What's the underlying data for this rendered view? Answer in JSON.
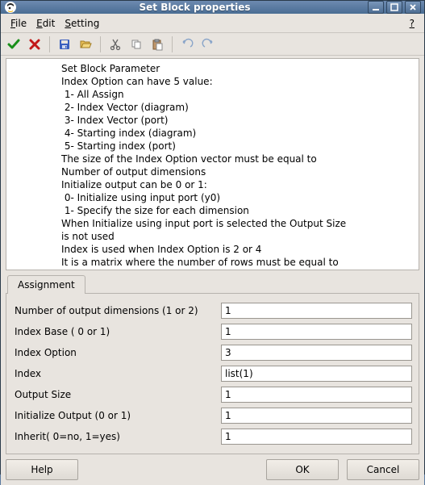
{
  "window": {
    "title": "Set Block properties"
  },
  "menu": {
    "file": "File",
    "edit": "Edit",
    "setting": "Setting",
    "help_q": "?"
  },
  "toolbar": {
    "ok_name": "apply-ok-icon",
    "cancel_name": "cancel-icon",
    "save_name": "save-icon",
    "open_name": "open-icon",
    "cut_name": "cut-icon",
    "copy_name": "copy-icon",
    "paste_name": "paste-icon",
    "undo_name": "undo-icon",
    "redo_name": "redo-icon"
  },
  "description": "Set Block Parameter\nIndex Option can have 5 value:\n 1- All Assign\n 2- Index Vector (diagram)\n 3- Index Vector (port)\n 4- Starting index (diagram)\n 5- Starting index (port)\nThe size of the Index Option vector must be equal to\nNumber of output dimensions\nInitialize output can be 0 or 1:\n 0- Initialize using input port (y0)\n 1- Specify the size for each dimension\nWhen Initialize using input port is selected the Output Size\nis not used\nIndex is used when Index Option is 2 or 4\nIt is a matrix where the number of rows must be equal to\nNumber of output dimensions",
  "tab": {
    "label": "Assignment"
  },
  "fields": {
    "num_out_dim": {
      "label": "Number of output dimensions (1 or 2)",
      "value": "1"
    },
    "index_base": {
      "label": "Index Base ( 0 or 1)",
      "value": "1"
    },
    "index_opt": {
      "label": "Index Option",
      "value": "3"
    },
    "index": {
      "label": "Index",
      "value": "list(1)"
    },
    "output_size": {
      "label": "Output Size",
      "value": "1"
    },
    "init_output": {
      "label": "Initialize Output (0 or 1)",
      "value": "1"
    },
    "inherit": {
      "label": "Inherit( 0=no, 1=yes)",
      "value": "1"
    }
  },
  "buttons": {
    "help": "Help",
    "ok": "OK",
    "cancel": "Cancel"
  }
}
